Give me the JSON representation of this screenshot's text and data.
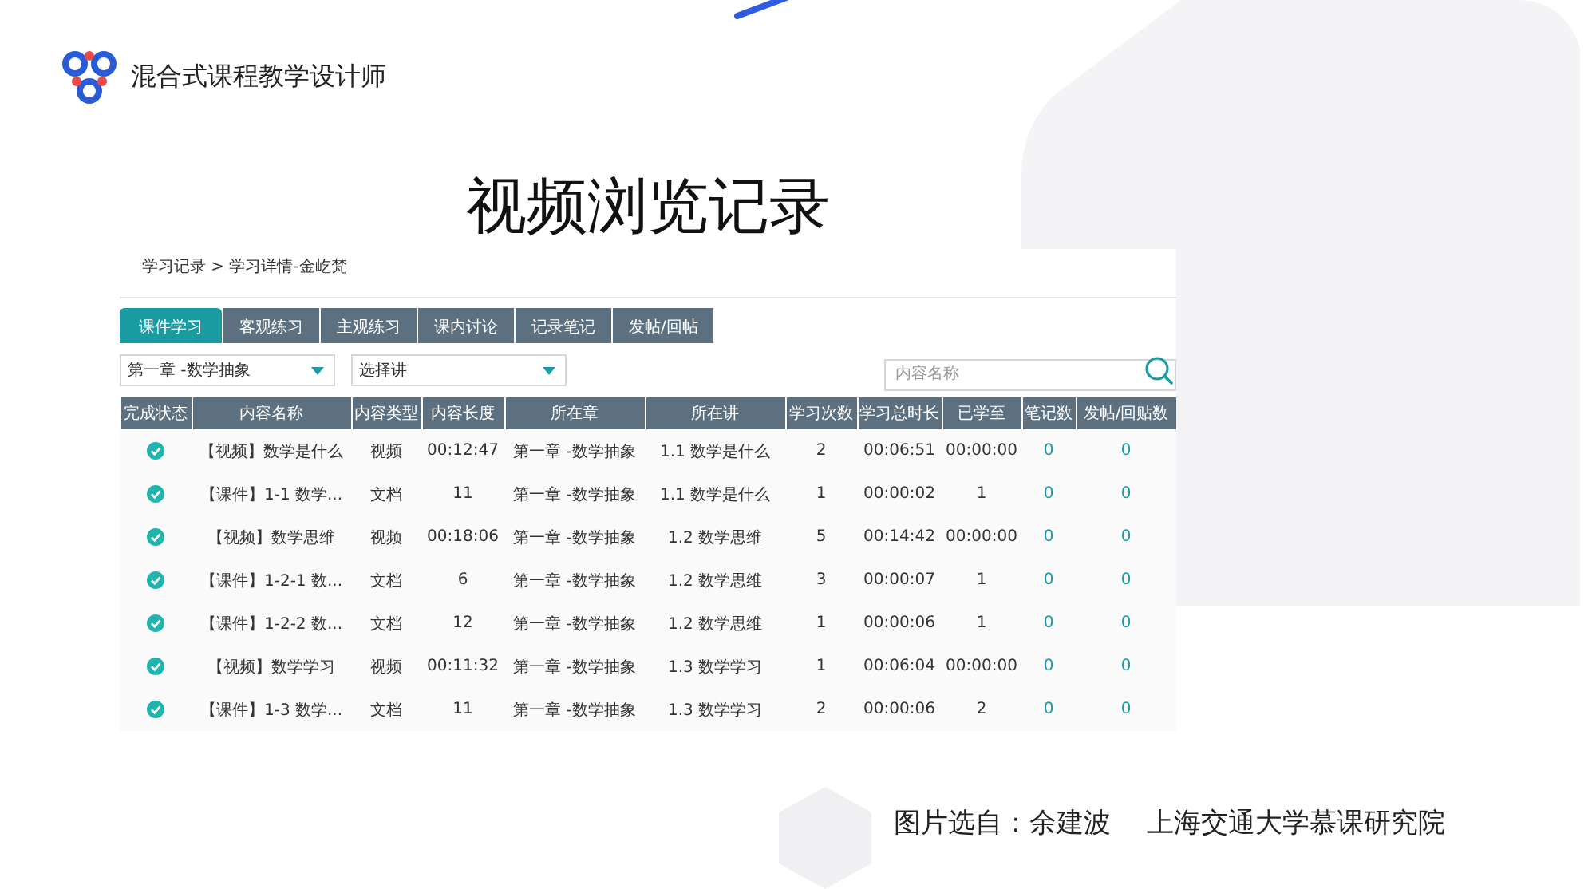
{
  "brand": {
    "name": "混合式课程教学设计师"
  },
  "title": "视频浏览记录",
  "screenshot": {
    "breadcrumb": "学习记录 > 学习详情-金屹梵",
    "tabs": [
      {
        "label": "课件学习",
        "selected": true
      },
      {
        "label": "客观练习",
        "selected": false
      },
      {
        "label": "主观练习",
        "selected": false
      },
      {
        "label": "课内讨论",
        "selected": false
      },
      {
        "label": "记录笔记",
        "selected": false
      },
      {
        "label": "发帖/回帖",
        "selected": false
      }
    ],
    "filters": [
      {
        "value": "第一章 -数学抽象"
      },
      {
        "value": "选择讲"
      }
    ],
    "search": {
      "placeholder": "内容名称"
    },
    "table": {
      "columns": [
        "完成状态",
        "内容名称",
        "内容类型",
        "内容长度",
        "所在章",
        "所在讲",
        "学习次数",
        "学习总时长",
        "已学至",
        "笔记数",
        "发帖/回贴数"
      ],
      "rows": [
        {
          "completed": true,
          "cells": [
            "",
            "【视频】数学是什么",
            "视频",
            "00:12:47",
            "第一章 -数学抽象",
            "1.1 数学是什么",
            "2",
            "00:06:51",
            "00:00:00",
            "0",
            "0"
          ]
        },
        {
          "completed": true,
          "cells": [
            "",
            "【课件】1-1 数学...",
            "文档",
            "11",
            "第一章 -数学抽象",
            "1.1 数学是什么",
            "1",
            "00:00:02",
            "1",
            "0",
            "0"
          ]
        },
        {
          "completed": true,
          "cells": [
            "",
            "【视频】数学思维",
            "视频",
            "00:18:06",
            "第一章 -数学抽象",
            "1.2 数学思维",
            "5",
            "00:14:42",
            "00:00:00",
            "0",
            "0"
          ]
        },
        {
          "completed": true,
          "cells": [
            "",
            "【课件】1-2-1 数...",
            "文档",
            "6",
            "第一章 -数学抽象",
            "1.2 数学思维",
            "3",
            "00:00:07",
            "1",
            "0",
            "0"
          ]
        },
        {
          "completed": true,
          "cells": [
            "",
            "【课件】1-2-2 数...",
            "文档",
            "12",
            "第一章 -数学抽象",
            "1.2 数学思维",
            "1",
            "00:00:06",
            "1",
            "0",
            "0"
          ]
        },
        {
          "completed": true,
          "cells": [
            "",
            "【视频】数学学习",
            "视频",
            "00:11:32",
            "第一章 -数学抽象",
            "1.3 数学学习",
            "1",
            "00:06:04",
            "00:00:00",
            "0",
            "0"
          ]
        },
        {
          "completed": true,
          "cells": [
            "",
            "【课件】1-3 数学...",
            "文档",
            "11",
            "第一章 -数学抽象",
            "1.3 数学学习",
            "2",
            "00:00:06",
            "2",
            "0",
            "0"
          ]
        }
      ]
    }
  },
  "caption": "图片选自：余建波　 上海交通大学慕课研究院"
}
